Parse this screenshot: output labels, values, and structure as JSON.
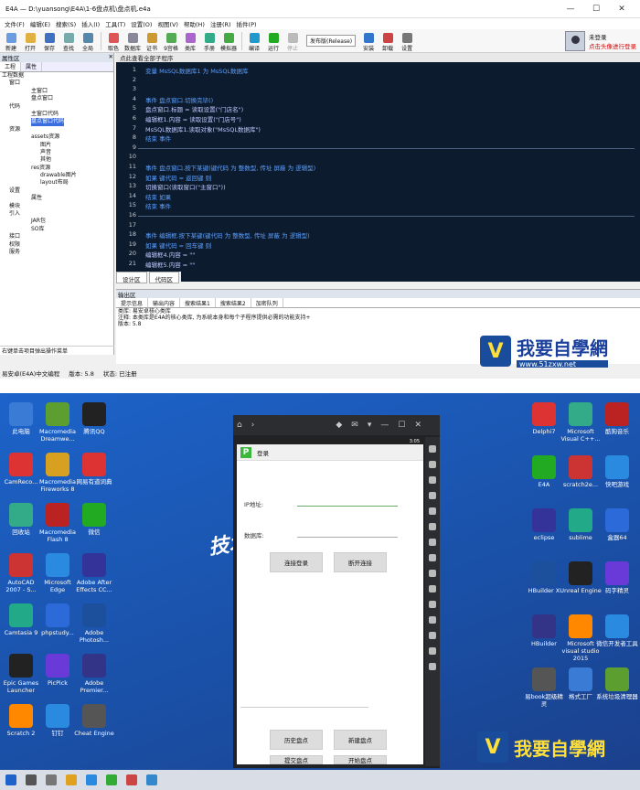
{
  "ide": {
    "title": "E4A — D:\\yuansong\\E4A\\1-6盘点机\\盘点机.e4a",
    "menu": [
      "文件(F)",
      "编辑(E)",
      "搜索(S)",
      "插入(I)",
      "工具(T)",
      "设置(O)",
      "视图(V)",
      "帮助(H)",
      "注册(R)",
      "插件(P)"
    ],
    "toolbar": [
      "新建",
      "打开",
      "保存",
      "查找",
      "全局",
      "取色",
      "数据库",
      "证书",
      "9宫格",
      "类库",
      "手册",
      "模拟器",
      "编译",
      "运行",
      "停止",
      "发布版(Release)",
      "安装",
      "卸载",
      "设置"
    ],
    "user": {
      "name": "未登录",
      "login_hint": "点击头像进行登录"
    },
    "left_title": "属性区",
    "left_tabs": [
      "工程",
      "属性"
    ],
    "tree": [
      "工程数据",
      "窗口",
      "主窗口",
      "盘点窗口",
      "代码",
      "主窗口代码",
      "盘点窗口代码",
      "资源",
      "assets资源",
      "图片",
      "声音",
      "其他",
      "res资源",
      "drawable图片",
      "layout布局",
      "设置",
      "属性",
      "模块",
      "引入",
      "JAR包",
      "SO库",
      "接口",
      "权限",
      "服务"
    ],
    "left_footer": "右键单击项目弹出操作菜单",
    "editor_header": "点此查看全部子程序",
    "code_lines": [
      {
        "n": "1",
        "t": "变量 MsSQL数据库1 为 MsSQL数据库",
        "c": "k"
      },
      {
        "n": "2",
        "t": ""
      },
      {
        "n": "3",
        "t": ""
      },
      {
        "n": "4",
        "t": "事件 盘点窗口.切换完毕()",
        "c": "k"
      },
      {
        "n": "5",
        "t": "  盘点窗口.标题 = 读取设置(\"门店名\")",
        "c": "v"
      },
      {
        "n": "6",
        "t": "  编辑框1.内容 = 读取设置(\"门店号\")",
        "c": "v"
      },
      {
        "n": "7",
        "t": "  MsSQL数据库1.读取对象(\"MsSQL数据库\")",
        "c": "v"
      },
      {
        "n": "8",
        "t": "结束 事件",
        "c": "k"
      },
      {
        "n": "9",
        "t": ""
      },
      {
        "n": "10",
        "t": ""
      },
      {
        "n": "11",
        "t": "事件 盘点窗口.按下某键(键代码 为 整数型, 传址 屏蔽 为 逻辑型)",
        "c": "k"
      },
      {
        "n": "12",
        "t": "  如果 键代码 = 返回键 则",
        "c": "k"
      },
      {
        "n": "13",
        "t": "    切换窗口(读取窗口(\"主窗口\"))",
        "c": "v"
      },
      {
        "n": "14",
        "t": "  结束 如果",
        "c": "k"
      },
      {
        "n": "15",
        "t": "结束 事件",
        "c": "k"
      },
      {
        "n": "16",
        "t": ""
      },
      {
        "n": "17",
        "t": ""
      },
      {
        "n": "18",
        "t": "事件 编辑框.按下某键(键代码 为 整数型, 传址 屏蔽 为 逻辑型)",
        "c": "k"
      },
      {
        "n": "19",
        "t": "  如果 键代码 = 回车键 则",
        "c": "k"
      },
      {
        "n": "20",
        "t": "  编辑框4.内容 = \"\"",
        "c": "v"
      },
      {
        "n": "21",
        "t": "  编辑框5.内容 = \"\"",
        "c": "v"
      }
    ],
    "editor_tabs": [
      "设计区",
      "代码区"
    ],
    "output_title": "输出区",
    "output_tabs": [
      "提示信息",
      "输出内容",
      "搜索结果1",
      "搜索结果2",
      "加密队列"
    ],
    "output_lines": [
      "类库: 易安卓核心类库",
      "注释: 本类库是E4A的核心类库, 为系统本身和每个子程序提供必需的功能支持+",
      "版本: 5.8"
    ],
    "status": [
      "易安卓(E4A)中文编程",
      "版本: 5.8",
      "状态: 已注册"
    ]
  },
  "watermark": {
    "text": "我要自學網",
    "url": "www.51zxw.net"
  },
  "emulator": {
    "app_title": "登录",
    "ip_label": "IP地址:",
    "db_label": "数据库:",
    "btn_connect": "连接登录",
    "btn_disconnect": "断开连接",
    "btn_history": "历史盘点",
    "btn_new": "新建盘点",
    "btn_submit": "提交盘点",
    "btn_start": "开始盘点",
    "clock": "3:05"
  },
  "desktop": {
    "left_icons": [
      "此电脑",
      "Macromedia Dreamwe...",
      "腾讯QQ",
      "CamReco...",
      "Macromedia Fireworks 8",
      "网易有道词典",
      "回收站",
      "Macromedia Flash 8",
      "微信",
      "AutoCAD 2007 - S...",
      "Microsoft Edge",
      "Adobe After Effects CC...",
      "Camtasia 9",
      "phpstudy...",
      "Adobe Photosh...",
      "Epic Games Launcher",
      "PicPick",
      "Adobe Premier...",
      "Scratch 2",
      "钉钉",
      "Cheat Engine"
    ],
    "right_icons": [
      "Delphi7",
      "Microsoft Visual C++...",
      "酷狗音乐",
      "E4A",
      "scratch2e...",
      "快吧游戏",
      "eclipse",
      "sublime",
      "盒器64",
      "HBuilder X",
      "Unreal Engine",
      "码字精灵",
      "HBuilder",
      "Microsoft visual studio 2015",
      "微信开发者工具",
      "易book超级精灵",
      "格式工厂",
      "系统垃圾清理器"
    ],
    "banner": "技术"
  }
}
